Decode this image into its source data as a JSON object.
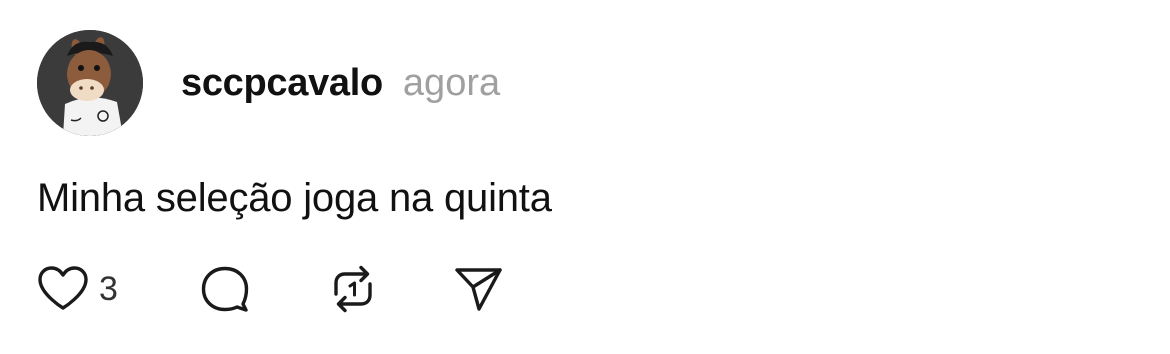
{
  "post": {
    "username": "sccpcavalo",
    "timestamp": "agora",
    "text": "Minha seleção joga na quinta"
  },
  "actions": {
    "like_count": "3",
    "icons": [
      "heart-icon",
      "comment-icon",
      "repost-icon",
      "send-icon"
    ]
  },
  "colors": {
    "text": "#111111",
    "muted": "#a0a0a0",
    "icon": "#1a1a1a"
  }
}
